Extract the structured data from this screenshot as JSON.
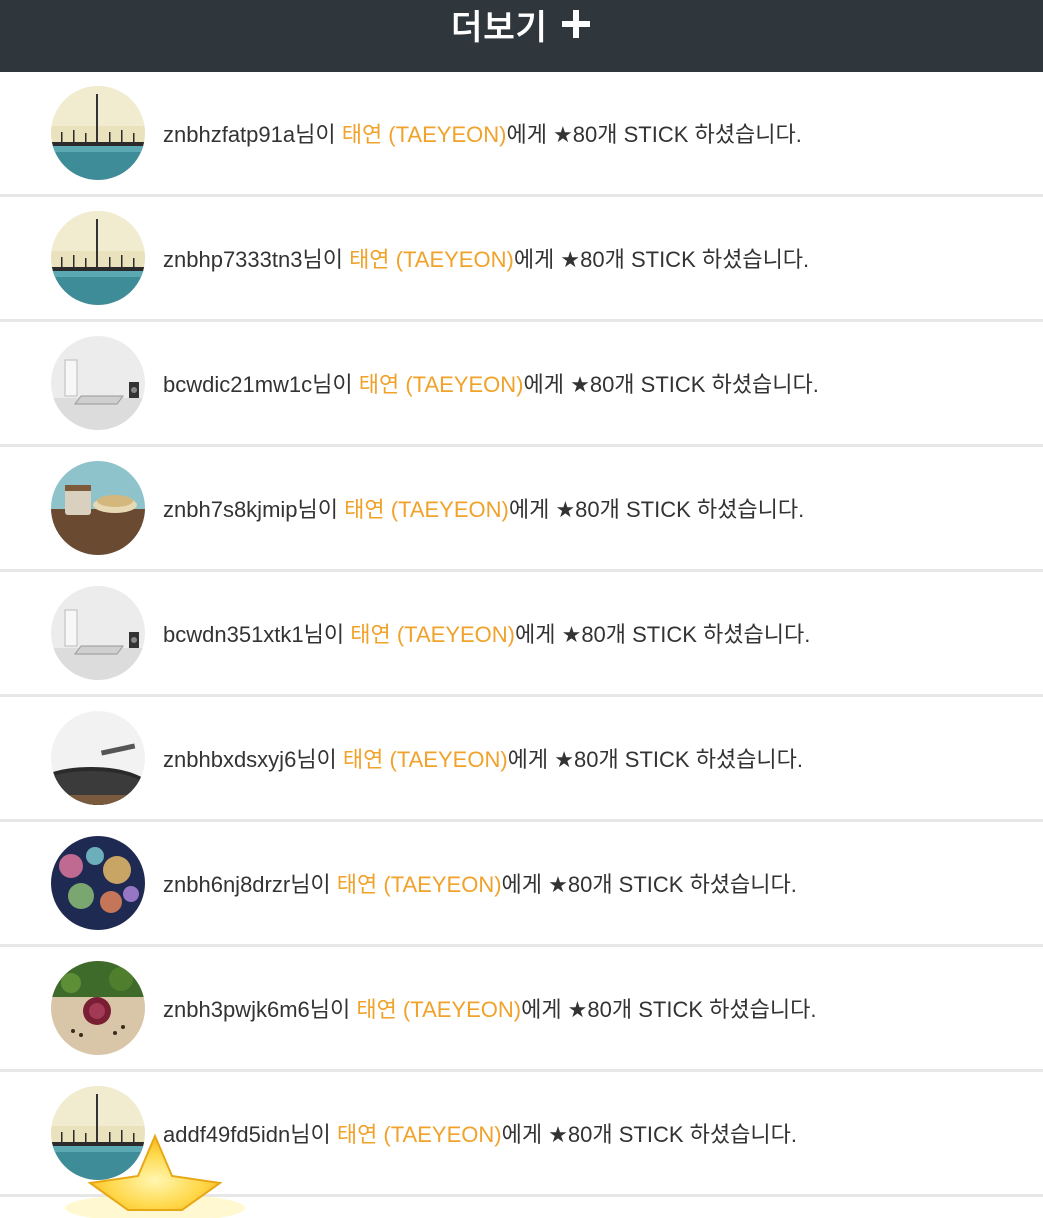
{
  "header": {
    "more_label": "더보기",
    "more_icon": "plus-icon"
  },
  "colors": {
    "header_bg": "#2f373d",
    "artist_highlight": "#f0a22a",
    "text": "#333333",
    "divider": "#e7e7e7"
  },
  "stick_feed": [
    {
      "user": "znbhzfatp91a",
      "avatar": "sea-pier-avatar",
      "suffix": "님이 ",
      "artist": "태연 (TAEYEON)",
      "message": "에게 ★80개 STICK 하셨습니다."
    },
    {
      "user": "znbhp7333tn3",
      "avatar": "sea-pier-avatar",
      "suffix": "님이 ",
      "artist": "태연 (TAEYEON)",
      "message": "에게 ★80개 STICK 하셨습니다."
    },
    {
      "user": "bcwdic21mw1c",
      "avatar": "laptop-desk-avatar",
      "suffix": "님이 ",
      "artist": "태연 (TAEYEON)",
      "message": "에게 ★80개 STICK 하셨습니다."
    },
    {
      "user": "znbh7s8kjmip",
      "avatar": "coffee-cup-avatar",
      "suffix": "님이 ",
      "artist": "태연 (TAEYEON)",
      "message": "에게 ★80개 STICK 하셨습니다."
    },
    {
      "user": "bcwdn351xtk1",
      "avatar": "laptop-desk-avatar",
      "suffix": "님이 ",
      "artist": "태연 (TAEYEON)",
      "message": "에게 ★80개 STICK 하셨습니다."
    },
    {
      "user": "znbhbxdsxyj6",
      "avatar": "turntable-avatar",
      "suffix": "님이 ",
      "artist": "태연 (TAEYEON)",
      "message": "에게 ★80개 STICK 하셨습니다."
    },
    {
      "user": "znbh6nj8drzr",
      "avatar": "bokeh-lights-avatar",
      "suffix": "님이 ",
      "artist": "태연 (TAEYEON)",
      "message": "에게 ★80개 STICK 하셨습니다."
    },
    {
      "user": "znbh3pwjk6m6",
      "avatar": "onion-herbs-avatar",
      "suffix": "님이 ",
      "artist": "태연 (TAEYEON)",
      "message": "에게 ★80개 STICK 하셨습니다."
    },
    {
      "user": "addf49fd5idn",
      "avatar": "sea-pier-avatar",
      "suffix": "님이 ",
      "artist": "태연 (TAEYEON)",
      "message": "에게 ★80개 STICK 하셨습니다."
    }
  ]
}
